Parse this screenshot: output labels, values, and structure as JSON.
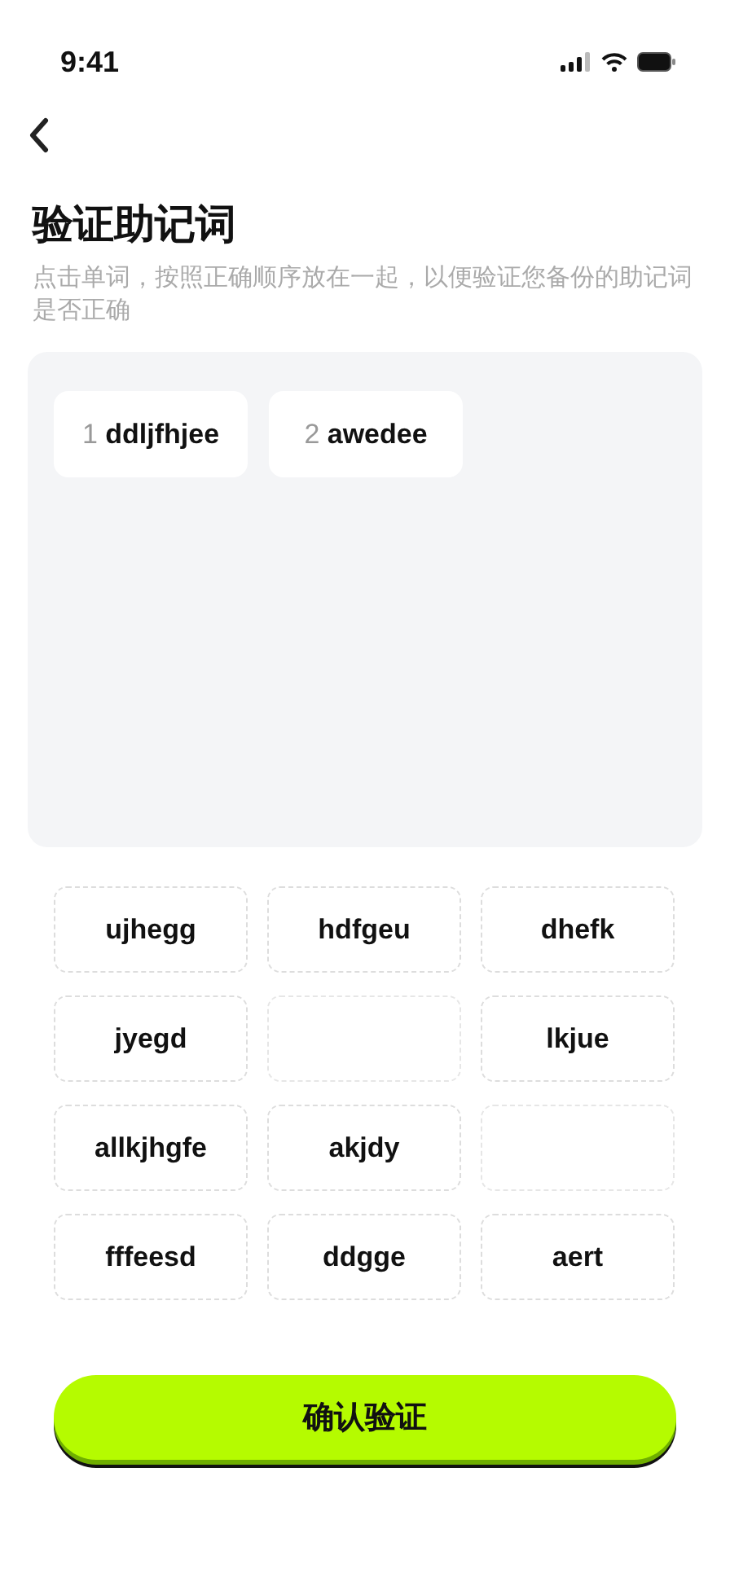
{
  "status_bar": {
    "time": "9:41"
  },
  "title": "验证助记词",
  "description": "点击单词，按照正确顺序放在一起，以便验证您备份的助记词是否正确",
  "selected_words": [
    {
      "index": "1",
      "word": "ddljfhjee"
    },
    {
      "index": "2",
      "word": "awedee"
    }
  ],
  "word_options": [
    {
      "word": "ujhegg",
      "used": false
    },
    {
      "word": "hdfgeu",
      "used": false
    },
    {
      "word": "dhefk",
      "used": false
    },
    {
      "word": "jyegd",
      "used": false
    },
    {
      "kind": "empty"
    },
    {
      "word": "lkjue",
      "used": false
    },
    {
      "word": "allkjhgfe",
      "used": false
    },
    {
      "word": "akjdy",
      "used": false
    },
    {
      "kind": "empty"
    },
    {
      "word": "fffeesd",
      "used": false
    },
    {
      "word": "ddgge",
      "used": false
    },
    {
      "word": "aert",
      "used": false
    }
  ],
  "confirm_button": "确认验证"
}
